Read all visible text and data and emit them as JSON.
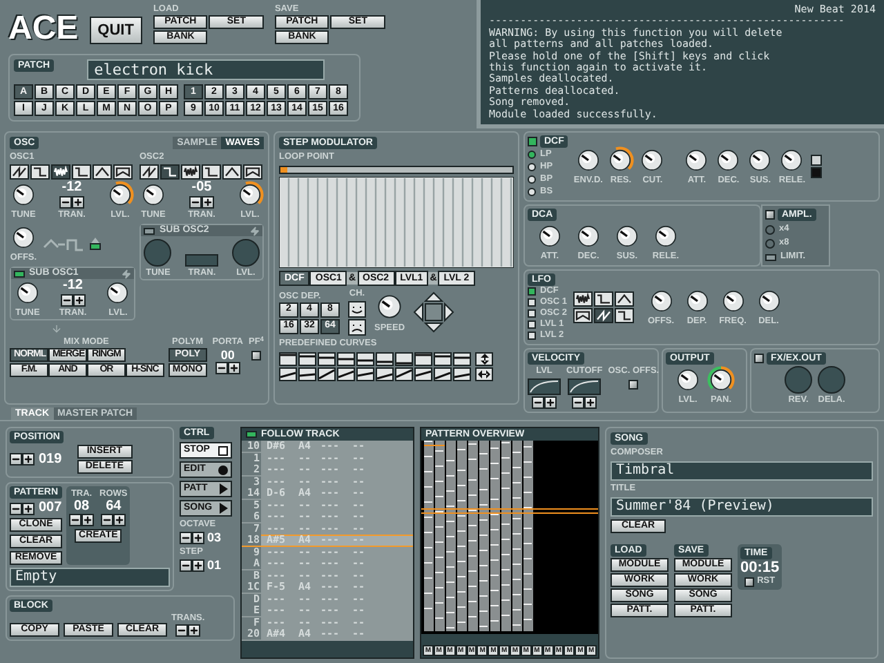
{
  "header": {
    "logo": "ACE",
    "quit": "QUIT",
    "load": {
      "label": "LOAD",
      "buttons": [
        "PATCH",
        "SET",
        "BANK"
      ]
    },
    "save": {
      "label": "SAVE",
      "buttons": [
        "PATCH",
        "SET",
        "BANK"
      ]
    }
  },
  "console": {
    "title": "New Beat 2014",
    "rule": "---------------------------------------------------------",
    "lines": [
      "WARNING: By using this function you will delete",
      "all patterns and all patches loaded.",
      "Please hold one of the [Shift] keys and click",
      "this function again to activate it.",
      "Samples deallocated.",
      "Patterns deallocated.",
      "Song removed.",
      "Module loaded successfully."
    ]
  },
  "patch": {
    "label": "PATCH",
    "name": "electron kick",
    "banks": [
      {
        "label": "A",
        "selected": true
      },
      {
        "label": "B",
        "selected": false
      },
      {
        "label": "C",
        "selected": false
      },
      {
        "label": "D",
        "selected": false
      },
      {
        "label": "E",
        "selected": false
      },
      {
        "label": "F",
        "selected": false
      },
      {
        "label": "G",
        "selected": false
      },
      {
        "label": "H",
        "selected": false
      },
      {
        "label": "I",
        "selected": false
      },
      {
        "label": "J",
        "selected": false
      },
      {
        "label": "K",
        "selected": false
      },
      {
        "label": "L",
        "selected": false
      },
      {
        "label": "M",
        "selected": false
      },
      {
        "label": "N",
        "selected": false
      },
      {
        "label": "O",
        "selected": false
      },
      {
        "label": "P",
        "selected": false
      }
    ],
    "slots": [
      {
        "label": "1",
        "selected": true
      },
      {
        "label": "2",
        "selected": false
      },
      {
        "label": "3",
        "selected": false
      },
      {
        "label": "4",
        "selected": false
      },
      {
        "label": "5",
        "selected": false
      },
      {
        "label": "6",
        "selected": false
      },
      {
        "label": "7",
        "selected": false
      },
      {
        "label": "8",
        "selected": false
      },
      {
        "label": "9",
        "selected": false
      },
      {
        "label": "10",
        "selected": false
      },
      {
        "label": "11",
        "selected": false
      },
      {
        "label": "12",
        "selected": false
      },
      {
        "label": "13",
        "selected": false
      },
      {
        "label": "14",
        "selected": false
      },
      {
        "label": "15",
        "selected": false
      },
      {
        "label": "16",
        "selected": false
      }
    ]
  },
  "osc": {
    "title": "OSC",
    "tabs": [
      {
        "label": "SAMPLE",
        "selected": false
      },
      {
        "label": "WAVES",
        "selected": true
      }
    ],
    "oscillators": [
      {
        "name": "OSC1",
        "waves": [
          {
            "selected": false
          },
          {
            "selected": false
          },
          {
            "selected": true
          },
          {
            "selected": false
          },
          {
            "selected": false
          },
          {
            "selected": false
          }
        ],
        "tune": {
          "label": "TUNE",
          "kind": "plain"
        },
        "tran": {
          "value": "-12",
          "label": "TRAN."
        },
        "lvl": {
          "label": "LVL.",
          "kind": "arc"
        }
      },
      {
        "name": "OSC2",
        "waves": [
          {
            "selected": false
          },
          {
            "selected": true
          },
          {
            "selected": false
          },
          {
            "selected": false
          },
          {
            "selected": false
          },
          {
            "selected": false
          }
        ],
        "tune": {
          "label": "TUNE",
          "kind": "plain"
        },
        "tran": {
          "value": "-05",
          "label": "TRAN."
        },
        "lvl": {
          "label": "LVL.",
          "kind": "arc"
        }
      }
    ],
    "offs": {
      "label": "OFFS.",
      "kind": "plain"
    },
    "offs_toggle": {
      "on": true
    },
    "subs": [
      {
        "name": "SUB OSC2",
        "on": false,
        "tune": {
          "label": "TUNE",
          "kind": "empty"
        },
        "tran": {
          "label": "TRAN."
        },
        "lvl": {
          "label": "LVL.",
          "kind": "empty"
        }
      },
      {
        "name": "SUB OSC1",
        "on": true,
        "tune": {
          "label": "TUNE",
          "kind": "plain"
        },
        "tran": {
          "value": "-12",
          "label": "TRAN."
        },
        "lvl": {
          "label": "LVL.",
          "kind": "plain"
        }
      }
    ],
    "mix": {
      "label": "MIX MODE",
      "modes": [
        {
          "label": "NORML",
          "selected": true
        },
        {
          "label": "MERGE",
          "selected": false
        },
        {
          "label": "RINGM",
          "selected": false
        },
        {
          "label": "F.M.",
          "selected": false
        },
        {
          "label": "AND",
          "selected": false
        },
        {
          "label": "OR",
          "selected": false
        },
        {
          "label": "H-SNC",
          "selected": false
        }
      ]
    },
    "polym": {
      "label": "POLYM",
      "modes": [
        {
          "label": "POLY",
          "selected": true
        },
        {
          "label": "MONO",
          "selected": false
        }
      ]
    },
    "porta": {
      "label": "PORTA",
      "value": "00",
      "pf": "PF$^{4}$",
      "pf_checked": false
    }
  },
  "step": {
    "title": "STEP MODULATOR",
    "loop_label": "LOOP POINT",
    "loop_point": {
      "level": 0.03
    },
    "targets": [
      {
        "label": "DCF",
        "selected": true
      },
      {
        "label": "OSC1",
        "selected": false,
        "joiner": "&"
      },
      {
        "label": "OSC2",
        "selected": false
      },
      {
        "label": "LVL1",
        "selected": false,
        "joiner": "&"
      },
      {
        "label": "LVL 2",
        "selected": false
      }
    ],
    "depth": {
      "label": "OSC DEP.",
      "options": [
        {
          "label": "2",
          "selected": false
        },
        {
          "label": "4",
          "selected": false
        },
        {
          "label": "8",
          "selected": false
        },
        {
          "label": "16",
          "selected": false
        },
        {
          "label": "32",
          "selected": false
        },
        {
          "label": "64",
          "selected": true
        }
      ]
    },
    "ch_label": "CH.",
    "speed": {
      "label": "SPEED",
      "kind": "plain"
    },
    "curves_label": "PREDEFINED CURVES"
  },
  "dcf": {
    "title": "DCF",
    "on": true,
    "filters": [
      {
        "label": "LP",
        "selected": true
      },
      {
        "label": "HP",
        "selected": false
      },
      {
        "label": "BP",
        "selected": false
      },
      {
        "label": "BS",
        "selected": false
      }
    ],
    "knobs": [
      {
        "label": "ENV.D.",
        "kind": "plain"
      },
      {
        "label": "RES.",
        "kind": "arc"
      },
      {
        "label": "CUT.",
        "kind": "plain"
      },
      {
        "label": "ATT.",
        "kind": "plain"
      },
      {
        "label": "DEC.",
        "kind": "plain"
      },
      {
        "label": "SUS.",
        "kind": "plain"
      },
      {
        "label": "RELE.",
        "kind": "plain"
      }
    ],
    "env_modes": [
      {
        "selected": false
      },
      {
        "selected": true
      }
    ]
  },
  "dca": {
    "title": "DCA",
    "knobs": [
      {
        "label": "ATT.",
        "kind": "plain"
      },
      {
        "label": "DEC.",
        "kind": "plain"
      },
      {
        "label": "SUS.",
        "kind": "plain"
      },
      {
        "label": "RELE.",
        "kind": "plain"
      }
    ],
    "ampl": {
      "label": "AMPL.",
      "checked": false
    },
    "mult": [
      {
        "label": "x4",
        "selected": false
      },
      {
        "label": "x8",
        "selected": false
      }
    ],
    "limit": {
      "label": "LIMIT.",
      "on": false
    }
  },
  "lfo": {
    "title": "LFO",
    "targets": [
      {
        "label": "DCF",
        "selected": true
      },
      {
        "label": "OSC 1",
        "selected": false
      },
      {
        "label": "OSC 2",
        "selected": false
      },
      {
        "label": "LVL 1",
        "selected": false
      },
      {
        "label": "LVL 2",
        "selected": false
      }
    ],
    "waves": [
      {
        "selected": false
      },
      {
        "selected": false
      },
      {
        "selected": false
      },
      {
        "selected": false
      },
      {
        "selected": true
      },
      {
        "selected": false
      }
    ],
    "knobs": [
      {
        "label": "OFFS.",
        "kind": "plain"
      },
      {
        "label": "DEP.",
        "kind": "plain"
      },
      {
        "label": "FREQ.",
        "kind": "plain"
      },
      {
        "label": "DEL.",
        "kind": "plain"
      }
    ]
  },
  "velocity": {
    "title": "VELOCITY",
    "curves": [
      {
        "label": "LVL"
      },
      {
        "label": "CUTOFF"
      }
    ],
    "osc_offs": {
      "label": "OSC. OFFS.",
      "checked": false
    }
  },
  "output": {
    "title": "OUTPUT",
    "knobs": [
      {
        "label": "LVL.",
        "kind": "plain"
      },
      {
        "label": "PAN.",
        "kind": "pan"
      }
    ]
  },
  "fx": {
    "title": "FX/EX.OUT",
    "checked": false,
    "knobs": [
      {
        "label": "REV.",
        "kind": "empty"
      },
      {
        "label": "DELA.",
        "kind": "empty"
      }
    ]
  },
  "track_tabs": [
    {
      "label": "TRACK",
      "selected": true
    },
    {
      "label": "MASTER PATCH",
      "selected": false
    }
  ],
  "position": {
    "title": "POSITION",
    "value": "019",
    "buttons": [
      "INSERT",
      "DELETE"
    ]
  },
  "pattern": {
    "title": "PATTERN",
    "value": "007",
    "buttons": [
      "CLONE",
      "CLEAR",
      "REMOVE"
    ],
    "tra": {
      "label": "TRA.",
      "value": "08"
    },
    "rows": {
      "label": "ROWS",
      "value": "64"
    },
    "create": "CREATE",
    "name": "Empty"
  },
  "block": {
    "title": "BLOCK",
    "buttons": [
      "COPY",
      "PASTE",
      "CLEAR"
    ],
    "trans_label": "TRANS."
  },
  "ctrl": {
    "title": "CTRL",
    "buttons": [
      {
        "label": "STOP",
        "kind": "stop",
        "selected": true
      },
      {
        "label": "EDIT",
        "kind": "record",
        "selected": false
      },
      {
        "label": "PATT",
        "kind": "play",
        "selected": false
      },
      {
        "label": "SONG",
        "kind": "play",
        "selected": false
      }
    ],
    "octave": {
      "label": "OCTAVE",
      "value": "03"
    },
    "step": {
      "label": "STEP",
      "value": "01"
    }
  },
  "follow": {
    "title": "FOLLOW TRACK",
    "on": true,
    "rows": [
      {
        "line": "10",
        "cells": [
          "D#6",
          "A4",
          "---",
          "--"
        ],
        "selected": false
      },
      {
        "line": "1",
        "cells": [
          "---",
          "--",
          "---",
          "--"
        ],
        "selected": false
      },
      {
        "line": "2",
        "cells": [
          "---",
          "--",
          "---",
          "--"
        ],
        "selected": false
      },
      {
        "line": "3",
        "cells": [
          "---",
          "--",
          "---",
          "--"
        ],
        "selected": false
      },
      {
        "line": "14",
        "cells": [
          "D-6",
          "A4",
          "---",
          "--"
        ],
        "selected": false
      },
      {
        "line": "5",
        "cells": [
          "---",
          "--",
          "---",
          "--"
        ],
        "selected": false
      },
      {
        "line": "6",
        "cells": [
          "---",
          "--",
          "---",
          "--"
        ],
        "selected": false
      },
      {
        "line": "7",
        "cells": [
          "---",
          "--",
          "---",
          "--"
        ],
        "selected": false
      },
      {
        "line": "18",
        "cells": [
          "A#5",
          "A4",
          "---",
          "--"
        ],
        "selected": true
      },
      {
        "line": "9",
        "cells": [
          "---",
          "--",
          "---",
          "--"
        ],
        "selected": false
      },
      {
        "line": "A",
        "cells": [
          "---",
          "--",
          "---",
          "--"
        ],
        "selected": false
      },
      {
        "line": "B",
        "cells": [
          "---",
          "--",
          "---",
          "--"
        ],
        "selected": false
      },
      {
        "line": "1C",
        "cells": [
          "F-5",
          "A4",
          "---",
          "--"
        ],
        "selected": false
      },
      {
        "line": "D",
        "cells": [
          "---",
          "--",
          "---",
          "--"
        ],
        "selected": false
      },
      {
        "line": "E",
        "cells": [
          "---",
          "--",
          "---",
          "--"
        ],
        "selected": false
      },
      {
        "line": "F",
        "cells": [
          "---",
          "--",
          "---",
          "--"
        ],
        "selected": false
      },
      {
        "line": "20",
        "cells": [
          "A#4",
          "A4",
          "---",
          "--"
        ],
        "selected": false
      }
    ]
  },
  "overview": {
    "title": "PATTERN OVERVIEW",
    "mutes": [
      "M",
      "M",
      "M",
      "M",
      "M",
      "M",
      "M",
      "M",
      "M",
      "M",
      "M",
      "M",
      "M",
      "M",
      "M",
      "M"
    ]
  },
  "song": {
    "title": "SONG",
    "composer_label": "COMPOSER",
    "composer": "Timbral",
    "title_label": "TITLE",
    "title_value": "Summer'84 (Preview)",
    "clear": "CLEAR"
  },
  "song_load": {
    "label": "LOAD",
    "buttons": [
      "MODULE",
      "WORK",
      "SONG",
      "PATT."
    ]
  },
  "song_save": {
    "label": "SAVE",
    "buttons": [
      "MODULE",
      "WORK",
      "SONG",
      "PATT."
    ]
  },
  "time": {
    "label": "TIME",
    "value": "00:15",
    "rst": {
      "label": "RST",
      "checked": false
    }
  }
}
